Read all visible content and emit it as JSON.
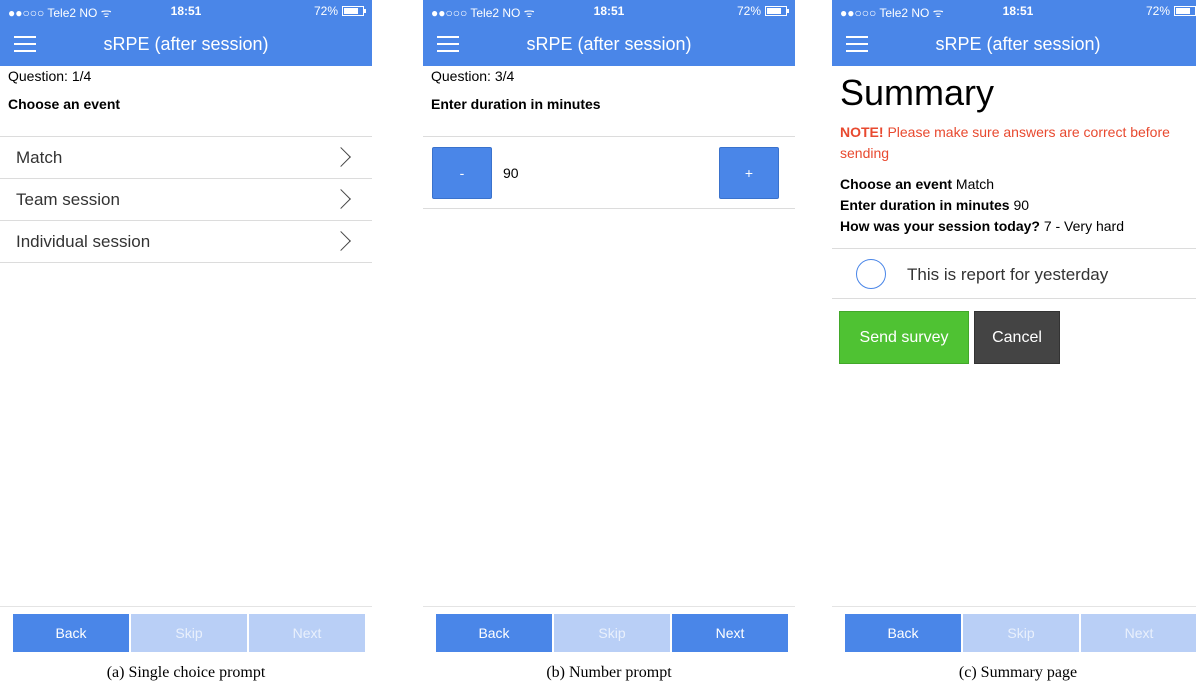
{
  "status_bar": {
    "carrier": "●●○○○ Tele2 NO ᯤ",
    "time": "18:51",
    "battery": "72%"
  },
  "nav": {
    "title": "sRPE (after session)"
  },
  "screen_a": {
    "question_num": "Question: 1/4",
    "prompt": "Choose an event",
    "choices": [
      "Match",
      "Team session",
      "Individual session"
    ],
    "bottom": {
      "back": "Back",
      "skip": "Skip",
      "next": "Next"
    }
  },
  "screen_b": {
    "question_num": "Question: 3/4",
    "prompt": "Enter duration in minutes",
    "minus": "-",
    "plus": "+",
    "value": "90",
    "bottom": {
      "back": "Back",
      "skip": "Skip",
      "next": "Next"
    }
  },
  "screen_c": {
    "title": "Summary",
    "note_label": "NOTE!",
    "note_text": " Please make sure answers are correct before sending",
    "answers": [
      {
        "q": "Choose an event",
        "a": " Match"
      },
      {
        "q": "Enter duration in minutes",
        "a": " 90"
      },
      {
        "q": "How was your session today?",
        "a": " 7 - Very hard"
      }
    ],
    "radio_label": "This is report for yesterday",
    "send": "Send survey",
    "cancel": "Cancel",
    "bottom": {
      "back": "Back",
      "skip": "Skip",
      "next": "Next"
    }
  },
  "captions": {
    "a": "(a)  Single choice prompt",
    "b": "(b)  Number prompt",
    "c": "(c)  Summary page"
  },
  "colors": {
    "header": "#4a86e8",
    "disabled": "#b9cff6",
    "send": "#4fc233",
    "cancel": "#444444",
    "note": "#e8492f"
  }
}
